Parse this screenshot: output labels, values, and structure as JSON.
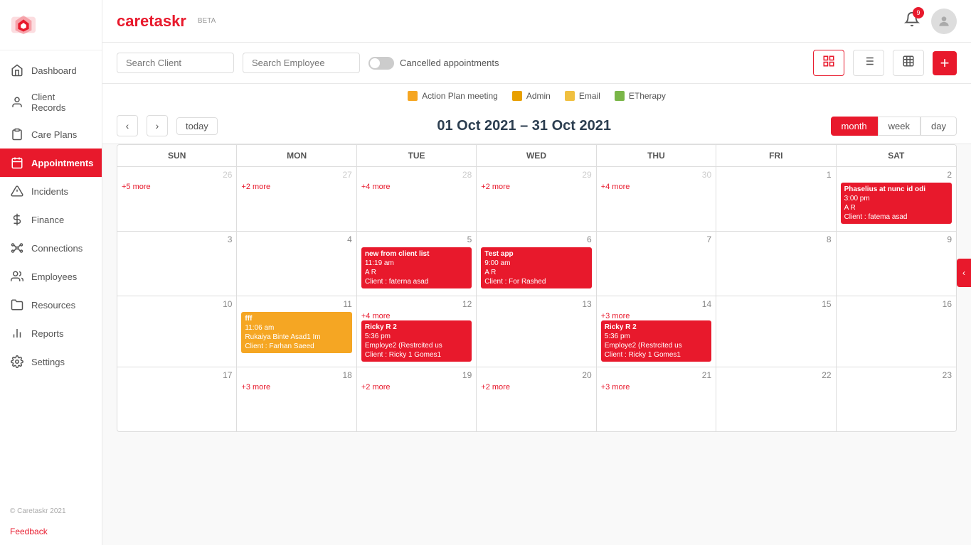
{
  "brand": {
    "name": "caretaskr",
    "beta": "BETA"
  },
  "sidebar": {
    "items": [
      {
        "id": "dashboard",
        "label": "Dashboard",
        "icon": "home"
      },
      {
        "id": "client-records",
        "label": "Client Records",
        "icon": "person"
      },
      {
        "id": "care-plans",
        "label": "Care Plans",
        "icon": "clipboard"
      },
      {
        "id": "appointments",
        "label": "Appointments",
        "icon": "calendar",
        "active": true
      },
      {
        "id": "incidents",
        "label": "Incidents",
        "icon": "alert"
      },
      {
        "id": "finance",
        "label": "Finance",
        "icon": "dollar"
      },
      {
        "id": "connections",
        "label": "Connections",
        "icon": "network"
      },
      {
        "id": "employees",
        "label": "Employees",
        "icon": "users"
      },
      {
        "id": "resources",
        "label": "Resources",
        "icon": "folder"
      },
      {
        "id": "reports",
        "label": "Reports",
        "icon": "chart"
      },
      {
        "id": "settings",
        "label": "Settings",
        "icon": "gear"
      }
    ],
    "footer": "© Caretaskr 2021",
    "feedback": "Feedback"
  },
  "toolbar": {
    "search_client_placeholder": "Search Client",
    "search_employee_placeholder": "Search Employee",
    "cancelled_appointments_label": "Cancelled appointments",
    "add_button_label": "+"
  },
  "legend": {
    "items": [
      {
        "label": "Action Plan meeting",
        "color": "#f5a623"
      },
      {
        "label": "Admin",
        "color": "#e8a000"
      },
      {
        "label": "Email",
        "color": "#f0c040"
      },
      {
        "label": "ETherapy",
        "color": "#7ab648"
      }
    ]
  },
  "calendar": {
    "title": "01 Oct 2021 – 31 Oct 2021",
    "today_btn": "today",
    "period_buttons": [
      "month",
      "week",
      "day"
    ],
    "active_period": "month",
    "day_headers": [
      "SUN",
      "MON",
      "TUE",
      "WED",
      "THU",
      "FRI",
      "SAT"
    ],
    "weeks": [
      {
        "days": [
          {
            "date": "26",
            "dim": true,
            "more": "+5 more",
            "events": []
          },
          {
            "date": "27",
            "dim": true,
            "more": "+2 more",
            "events": []
          },
          {
            "date": "28",
            "dim": true,
            "more": "+4 more",
            "events": []
          },
          {
            "date": "29",
            "dim": true,
            "more": "+2 more",
            "events": []
          },
          {
            "date": "30",
            "dim": true,
            "more": "+4 more",
            "events": []
          },
          {
            "date": "1",
            "dim": false,
            "more": "",
            "events": []
          },
          {
            "date": "2",
            "dim": false,
            "more": "",
            "events": [
              {
                "title": "Phaselius at nunc id odi",
                "time": "3:00 pm",
                "emp": "A R",
                "client": "Client : fatema asad",
                "color": "red"
              }
            ]
          }
        ]
      },
      {
        "days": [
          {
            "date": "3",
            "dim": false,
            "more": "",
            "events": []
          },
          {
            "date": "4",
            "dim": false,
            "more": "",
            "events": []
          },
          {
            "date": "5",
            "dim": false,
            "more": "",
            "events": [
              {
                "title": "new from client list",
                "time": "11:19 am",
                "emp": "A R",
                "client": "Client : faterna asad",
                "color": "red"
              }
            ]
          },
          {
            "date": "6",
            "dim": false,
            "more": "",
            "events": [
              {
                "title": "Test app",
                "time": "9:00 am",
                "emp": "A R",
                "client": "Client : For Rashed",
                "color": "red"
              }
            ]
          },
          {
            "date": "7",
            "dim": false,
            "more": "",
            "events": []
          },
          {
            "date": "8",
            "dim": false,
            "more": "",
            "events": []
          },
          {
            "date": "9",
            "dim": false,
            "more": "",
            "events": []
          }
        ]
      },
      {
        "days": [
          {
            "date": "10",
            "dim": false,
            "more": "",
            "events": []
          },
          {
            "date": "11",
            "dim": false,
            "more": "",
            "events": [
              {
                "title": "fff",
                "time": "11:06 am",
                "emp": "Rukaiya Binte Asad1 Im",
                "client": "Client : Farhan Saeed",
                "color": "orange"
              }
            ]
          },
          {
            "date": "12",
            "dim": false,
            "more": "+4 more",
            "events": [
              {
                "title": "Ricky R 2",
                "time": "5:36 pm",
                "emp": "Employe2 (Restrcited us",
                "client": "Client : Ricky 1 Gomes1",
                "color": "red"
              }
            ]
          },
          {
            "date": "13",
            "dim": false,
            "more": "",
            "events": []
          },
          {
            "date": "14",
            "dim": false,
            "more": "+3 more",
            "events": [
              {
                "title": "Ricky R 2",
                "time": "5:36 pm",
                "emp": "Employe2 (Restrcited us",
                "client": "Client : Ricky 1 Gomes1",
                "color": "red"
              }
            ]
          },
          {
            "date": "15",
            "dim": false,
            "more": "",
            "events": []
          },
          {
            "date": "16",
            "dim": false,
            "more": "",
            "events": []
          }
        ]
      },
      {
        "days": [
          {
            "date": "17",
            "dim": false,
            "more": "",
            "events": []
          },
          {
            "date": "18",
            "dim": false,
            "more": "+3 more",
            "events": []
          },
          {
            "date": "19",
            "dim": false,
            "more": "+2 more",
            "events": []
          },
          {
            "date": "20",
            "dim": false,
            "more": "+2 more",
            "events": []
          },
          {
            "date": "21",
            "dim": false,
            "more": "+3 more",
            "events": []
          },
          {
            "date": "22",
            "dim": false,
            "more": "",
            "events": []
          },
          {
            "date": "23",
            "dim": false,
            "more": "",
            "events": []
          }
        ]
      }
    ]
  },
  "notification_count": "9",
  "colors": {
    "primary": "#e8192c",
    "orange": "#f5a623",
    "yellow": "#f0c040",
    "green": "#7ab648"
  }
}
